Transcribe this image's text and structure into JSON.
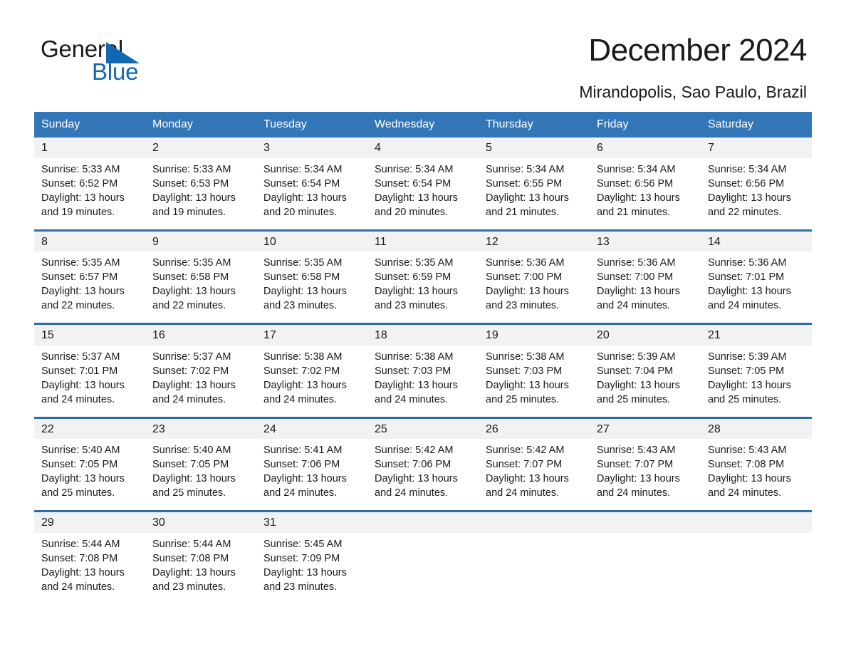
{
  "brand": {
    "name_part1": "General",
    "name_part2": "Blue",
    "accent_color": "#1268b3"
  },
  "header": {
    "title": "December 2024",
    "location": "Mirandopolis, Sao Paulo, Brazil",
    "header_bg_color": "#3376b8",
    "row_divider_color": "#2e6da4"
  },
  "calendar": {
    "weekday_headers": [
      "Sunday",
      "Monday",
      "Tuesday",
      "Wednesday",
      "Thursday",
      "Friday",
      "Saturday"
    ],
    "weeks": [
      [
        {
          "day": "1",
          "sunrise": "Sunrise: 5:33 AM",
          "sunset": "Sunset: 6:52 PM",
          "daylight": "Daylight: 13 hours and 19 minutes."
        },
        {
          "day": "2",
          "sunrise": "Sunrise: 5:33 AM",
          "sunset": "Sunset: 6:53 PM",
          "daylight": "Daylight: 13 hours and 19 minutes."
        },
        {
          "day": "3",
          "sunrise": "Sunrise: 5:34 AM",
          "sunset": "Sunset: 6:54 PM",
          "daylight": "Daylight: 13 hours and 20 minutes."
        },
        {
          "day": "4",
          "sunrise": "Sunrise: 5:34 AM",
          "sunset": "Sunset: 6:54 PM",
          "daylight": "Daylight: 13 hours and 20 minutes."
        },
        {
          "day": "5",
          "sunrise": "Sunrise: 5:34 AM",
          "sunset": "Sunset: 6:55 PM",
          "daylight": "Daylight: 13 hours and 21 minutes."
        },
        {
          "day": "6",
          "sunrise": "Sunrise: 5:34 AM",
          "sunset": "Sunset: 6:56 PM",
          "daylight": "Daylight: 13 hours and 21 minutes."
        },
        {
          "day": "7",
          "sunrise": "Sunrise: 5:34 AM",
          "sunset": "Sunset: 6:56 PM",
          "daylight": "Daylight: 13 hours and 22 minutes."
        }
      ],
      [
        {
          "day": "8",
          "sunrise": "Sunrise: 5:35 AM",
          "sunset": "Sunset: 6:57 PM",
          "daylight": "Daylight: 13 hours and 22 minutes."
        },
        {
          "day": "9",
          "sunrise": "Sunrise: 5:35 AM",
          "sunset": "Sunset: 6:58 PM",
          "daylight": "Daylight: 13 hours and 22 minutes."
        },
        {
          "day": "10",
          "sunrise": "Sunrise: 5:35 AM",
          "sunset": "Sunset: 6:58 PM",
          "daylight": "Daylight: 13 hours and 23 minutes."
        },
        {
          "day": "11",
          "sunrise": "Sunrise: 5:35 AM",
          "sunset": "Sunset: 6:59 PM",
          "daylight": "Daylight: 13 hours and 23 minutes."
        },
        {
          "day": "12",
          "sunrise": "Sunrise: 5:36 AM",
          "sunset": "Sunset: 7:00 PM",
          "daylight": "Daylight: 13 hours and 23 minutes."
        },
        {
          "day": "13",
          "sunrise": "Sunrise: 5:36 AM",
          "sunset": "Sunset: 7:00 PM",
          "daylight": "Daylight: 13 hours and 24 minutes."
        },
        {
          "day": "14",
          "sunrise": "Sunrise: 5:36 AM",
          "sunset": "Sunset: 7:01 PM",
          "daylight": "Daylight: 13 hours and 24 minutes."
        }
      ],
      [
        {
          "day": "15",
          "sunrise": "Sunrise: 5:37 AM",
          "sunset": "Sunset: 7:01 PM",
          "daylight": "Daylight: 13 hours and 24 minutes."
        },
        {
          "day": "16",
          "sunrise": "Sunrise: 5:37 AM",
          "sunset": "Sunset: 7:02 PM",
          "daylight": "Daylight: 13 hours and 24 minutes."
        },
        {
          "day": "17",
          "sunrise": "Sunrise: 5:38 AM",
          "sunset": "Sunset: 7:02 PM",
          "daylight": "Daylight: 13 hours and 24 minutes."
        },
        {
          "day": "18",
          "sunrise": "Sunrise: 5:38 AM",
          "sunset": "Sunset: 7:03 PM",
          "daylight": "Daylight: 13 hours and 24 minutes."
        },
        {
          "day": "19",
          "sunrise": "Sunrise: 5:38 AM",
          "sunset": "Sunset: 7:03 PM",
          "daylight": "Daylight: 13 hours and 25 minutes."
        },
        {
          "day": "20",
          "sunrise": "Sunrise: 5:39 AM",
          "sunset": "Sunset: 7:04 PM",
          "daylight": "Daylight: 13 hours and 25 minutes."
        },
        {
          "day": "21",
          "sunrise": "Sunrise: 5:39 AM",
          "sunset": "Sunset: 7:05 PM",
          "daylight": "Daylight: 13 hours and 25 minutes."
        }
      ],
      [
        {
          "day": "22",
          "sunrise": "Sunrise: 5:40 AM",
          "sunset": "Sunset: 7:05 PM",
          "daylight": "Daylight: 13 hours and 25 minutes."
        },
        {
          "day": "23",
          "sunrise": "Sunrise: 5:40 AM",
          "sunset": "Sunset: 7:05 PM",
          "daylight": "Daylight: 13 hours and 25 minutes."
        },
        {
          "day": "24",
          "sunrise": "Sunrise: 5:41 AM",
          "sunset": "Sunset: 7:06 PM",
          "daylight": "Daylight: 13 hours and 24 minutes."
        },
        {
          "day": "25",
          "sunrise": "Sunrise: 5:42 AM",
          "sunset": "Sunset: 7:06 PM",
          "daylight": "Daylight: 13 hours and 24 minutes."
        },
        {
          "day": "26",
          "sunrise": "Sunrise: 5:42 AM",
          "sunset": "Sunset: 7:07 PM",
          "daylight": "Daylight: 13 hours and 24 minutes."
        },
        {
          "day": "27",
          "sunrise": "Sunrise: 5:43 AM",
          "sunset": "Sunset: 7:07 PM",
          "daylight": "Daylight: 13 hours and 24 minutes."
        },
        {
          "day": "28",
          "sunrise": "Sunrise: 5:43 AM",
          "sunset": "Sunset: 7:08 PM",
          "daylight": "Daylight: 13 hours and 24 minutes."
        }
      ],
      [
        {
          "day": "29",
          "sunrise": "Sunrise: 5:44 AM",
          "sunset": "Sunset: 7:08 PM",
          "daylight": "Daylight: 13 hours and 24 minutes."
        },
        {
          "day": "30",
          "sunrise": "Sunrise: 5:44 AM",
          "sunset": "Sunset: 7:08 PM",
          "daylight": "Daylight: 13 hours and 23 minutes."
        },
        {
          "day": "31",
          "sunrise": "Sunrise: 5:45 AM",
          "sunset": "Sunset: 7:09 PM",
          "daylight": "Daylight: 13 hours and 23 minutes."
        },
        {
          "day": "",
          "sunrise": "",
          "sunset": "",
          "daylight": ""
        },
        {
          "day": "",
          "sunrise": "",
          "sunset": "",
          "daylight": ""
        },
        {
          "day": "",
          "sunrise": "",
          "sunset": "",
          "daylight": ""
        },
        {
          "day": "",
          "sunrise": "",
          "sunset": "",
          "daylight": ""
        }
      ]
    ]
  }
}
